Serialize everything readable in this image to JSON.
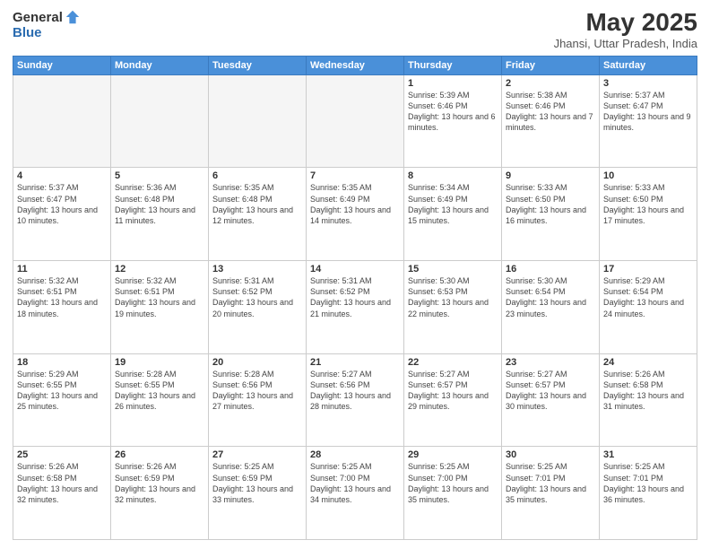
{
  "logo": {
    "general": "General",
    "blue": "Blue"
  },
  "title": "May 2025",
  "location": "Jhansi, Uttar Pradesh, India",
  "weekdays": [
    "Sunday",
    "Monday",
    "Tuesday",
    "Wednesday",
    "Thursday",
    "Friday",
    "Saturday"
  ],
  "weeks": [
    [
      {
        "day": "",
        "empty": true
      },
      {
        "day": "",
        "empty": true
      },
      {
        "day": "",
        "empty": true
      },
      {
        "day": "",
        "empty": true
      },
      {
        "day": "1",
        "sunrise": "5:39 AM",
        "sunset": "6:46 PM",
        "daylight": "13 hours and 6 minutes."
      },
      {
        "day": "2",
        "sunrise": "5:38 AM",
        "sunset": "6:46 PM",
        "daylight": "13 hours and 7 minutes."
      },
      {
        "day": "3",
        "sunrise": "5:37 AM",
        "sunset": "6:47 PM",
        "daylight": "13 hours and 9 minutes."
      }
    ],
    [
      {
        "day": "4",
        "sunrise": "5:37 AM",
        "sunset": "6:47 PM",
        "daylight": "13 hours and 10 minutes."
      },
      {
        "day": "5",
        "sunrise": "5:36 AM",
        "sunset": "6:48 PM",
        "daylight": "13 hours and 11 minutes."
      },
      {
        "day": "6",
        "sunrise": "5:35 AM",
        "sunset": "6:48 PM",
        "daylight": "13 hours and 12 minutes."
      },
      {
        "day": "7",
        "sunrise": "5:35 AM",
        "sunset": "6:49 PM",
        "daylight": "13 hours and 14 minutes."
      },
      {
        "day": "8",
        "sunrise": "5:34 AM",
        "sunset": "6:49 PM",
        "daylight": "13 hours and 15 minutes."
      },
      {
        "day": "9",
        "sunrise": "5:33 AM",
        "sunset": "6:50 PM",
        "daylight": "13 hours and 16 minutes."
      },
      {
        "day": "10",
        "sunrise": "5:33 AM",
        "sunset": "6:50 PM",
        "daylight": "13 hours and 17 minutes."
      }
    ],
    [
      {
        "day": "11",
        "sunrise": "5:32 AM",
        "sunset": "6:51 PM",
        "daylight": "13 hours and 18 minutes."
      },
      {
        "day": "12",
        "sunrise": "5:32 AM",
        "sunset": "6:51 PM",
        "daylight": "13 hours and 19 minutes."
      },
      {
        "day": "13",
        "sunrise": "5:31 AM",
        "sunset": "6:52 PM",
        "daylight": "13 hours and 20 minutes."
      },
      {
        "day": "14",
        "sunrise": "5:31 AM",
        "sunset": "6:52 PM",
        "daylight": "13 hours and 21 minutes."
      },
      {
        "day": "15",
        "sunrise": "5:30 AM",
        "sunset": "6:53 PM",
        "daylight": "13 hours and 22 minutes."
      },
      {
        "day": "16",
        "sunrise": "5:30 AM",
        "sunset": "6:54 PM",
        "daylight": "13 hours and 23 minutes."
      },
      {
        "day": "17",
        "sunrise": "5:29 AM",
        "sunset": "6:54 PM",
        "daylight": "13 hours and 24 minutes."
      }
    ],
    [
      {
        "day": "18",
        "sunrise": "5:29 AM",
        "sunset": "6:55 PM",
        "daylight": "13 hours and 25 minutes."
      },
      {
        "day": "19",
        "sunrise": "5:28 AM",
        "sunset": "6:55 PM",
        "daylight": "13 hours and 26 minutes."
      },
      {
        "day": "20",
        "sunrise": "5:28 AM",
        "sunset": "6:56 PM",
        "daylight": "13 hours and 27 minutes."
      },
      {
        "day": "21",
        "sunrise": "5:27 AM",
        "sunset": "6:56 PM",
        "daylight": "13 hours and 28 minutes."
      },
      {
        "day": "22",
        "sunrise": "5:27 AM",
        "sunset": "6:57 PM",
        "daylight": "13 hours and 29 minutes."
      },
      {
        "day": "23",
        "sunrise": "5:27 AM",
        "sunset": "6:57 PM",
        "daylight": "13 hours and 30 minutes."
      },
      {
        "day": "24",
        "sunrise": "5:26 AM",
        "sunset": "6:58 PM",
        "daylight": "13 hours and 31 minutes."
      }
    ],
    [
      {
        "day": "25",
        "sunrise": "5:26 AM",
        "sunset": "6:58 PM",
        "daylight": "13 hours and 32 minutes."
      },
      {
        "day": "26",
        "sunrise": "5:26 AM",
        "sunset": "6:59 PM",
        "daylight": "13 hours and 32 minutes."
      },
      {
        "day": "27",
        "sunrise": "5:25 AM",
        "sunset": "6:59 PM",
        "daylight": "13 hours and 33 minutes."
      },
      {
        "day": "28",
        "sunrise": "5:25 AM",
        "sunset": "7:00 PM",
        "daylight": "13 hours and 34 minutes."
      },
      {
        "day": "29",
        "sunrise": "5:25 AM",
        "sunset": "7:00 PM",
        "daylight": "13 hours and 35 minutes."
      },
      {
        "day": "30",
        "sunrise": "5:25 AM",
        "sunset": "7:01 PM",
        "daylight": "13 hours and 35 minutes."
      },
      {
        "day": "31",
        "sunrise": "5:25 AM",
        "sunset": "7:01 PM",
        "daylight": "13 hours and 36 minutes."
      }
    ]
  ]
}
